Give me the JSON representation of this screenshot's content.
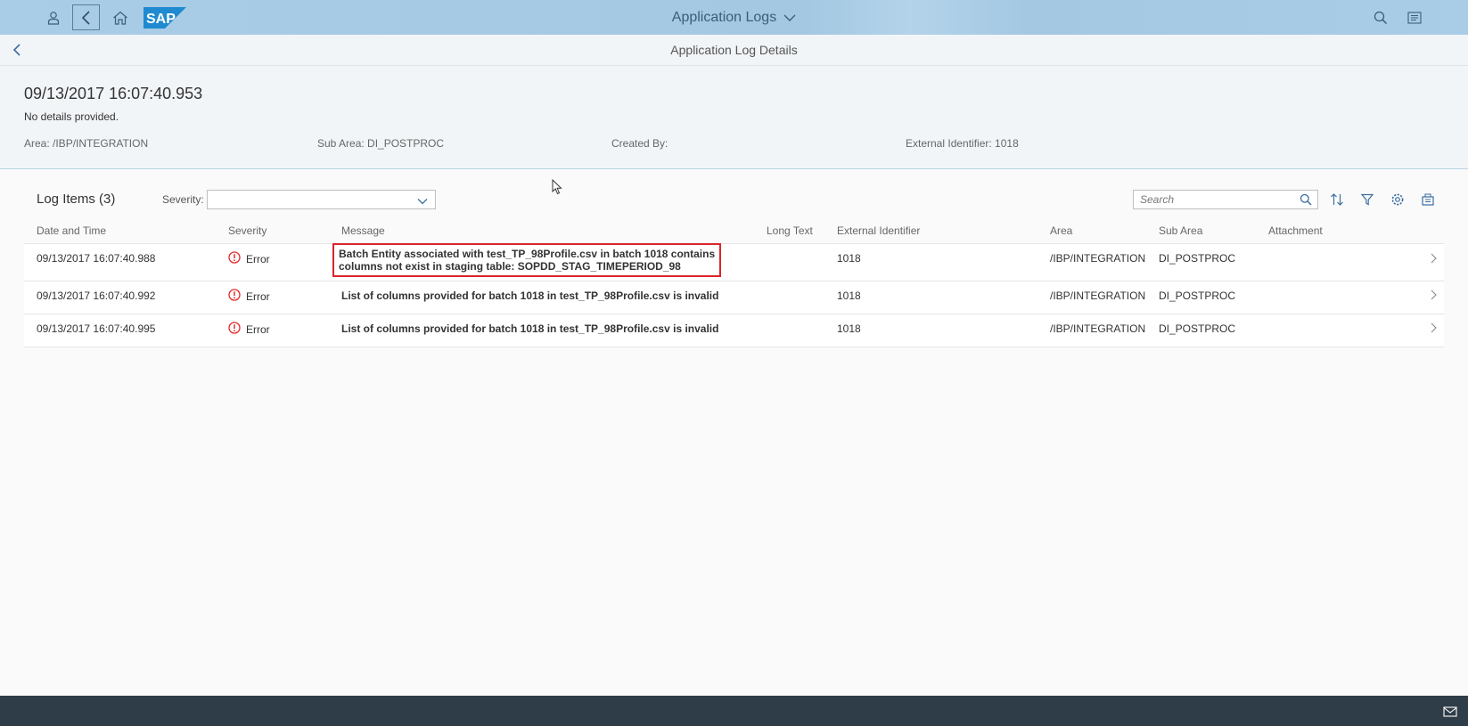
{
  "shell": {
    "title": "Application Logs",
    "logo_text": "SAP",
    "icons": [
      "user-icon",
      "back-icon",
      "home-icon",
      "search-icon",
      "menu-icon"
    ]
  },
  "subheader": {
    "title": "Application Log Details"
  },
  "object_header": {
    "timestamp": "09/13/2017 16:07:40.953",
    "description": "No details provided.",
    "area": "Area: /IBP/INTEGRATION",
    "sub_area": "Sub Area: DI_POSTPROC",
    "created_by": "Created By:",
    "external_id": "External Identifier: 1018"
  },
  "log_items": {
    "title": "Log Items (3)",
    "severity_label": "Severity:",
    "severity_value": "",
    "search_placeholder": "Search",
    "columns": {
      "date_time": "Date and Time",
      "severity": "Severity",
      "message": "Message",
      "long_text": "Long Text",
      "external_id": "External Identifier",
      "area": "Area",
      "sub_area": "Sub Area",
      "attachment": "Attachment"
    },
    "rows": [
      {
        "date_time": "09/13/2017 16:07:40.988",
        "severity": "Error",
        "message_line1": "Batch Entity associated with test_TP_98Profile.csv in batch 1018 contains",
        "message_line2": "columns not exist in staging table: SOPDD_STAG_TIMEPERIOD_98",
        "long_text": "",
        "external_id": "1018",
        "area": "/IBP/INTEGRATION",
        "sub_area": "DI_POSTPROC",
        "attachment": ""
      },
      {
        "date_time": "09/13/2017 16:07:40.992",
        "severity": "Error",
        "message_line1": "List of columns provided for batch 1018 in test_TP_98Profile.csv is invalid",
        "message_line2": "",
        "long_text": "",
        "external_id": "1018",
        "area": "/IBP/INTEGRATION",
        "sub_area": "DI_POSTPROC",
        "attachment": ""
      },
      {
        "date_time": "09/13/2017 16:07:40.995",
        "severity": "Error",
        "message_line1": "List of columns provided for batch 1018 in test_TP_98Profile.csv is invalid",
        "message_line2": "",
        "long_text": "",
        "external_id": "1018",
        "area": "/IBP/INTEGRATION",
        "sub_area": "DI_POSTPROC",
        "attachment": ""
      }
    ]
  },
  "colors": {
    "shell_bg": "#a7cbe4",
    "error": "#e52929",
    "highlight_box": "#d9252b",
    "footer_bg": "#2e3d48"
  }
}
